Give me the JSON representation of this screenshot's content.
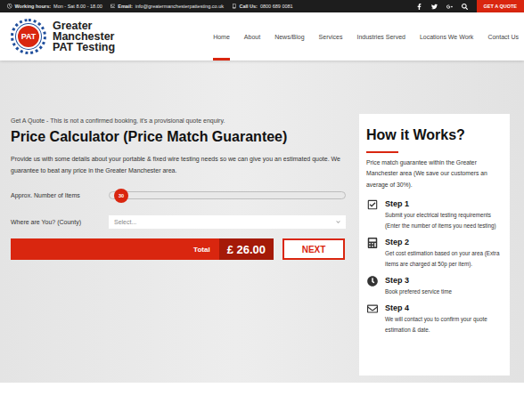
{
  "topbar": {
    "items": [
      {
        "label": "Working hours:",
        "value": "Mon - Sat 8.00 - 18.00"
      },
      {
        "label": "Email:",
        "value": "info@greatermanchesterpattesting.co.uk"
      },
      {
        "label": "Call Us:",
        "value": "0800 689 0081"
      }
    ],
    "quote_button": "GET A QUOTE"
  },
  "logo": {
    "badge": "PAT",
    "lines": [
      "Greater",
      "Manchester",
      "PAT Testing"
    ]
  },
  "nav": [
    {
      "label": "Home",
      "selected": true
    },
    {
      "label": "About",
      "selected": false
    },
    {
      "label": "News/Blog",
      "selected": false
    },
    {
      "label": "Services",
      "selected": false
    },
    {
      "label": "Industries Served",
      "selected": false
    },
    {
      "label": "Locations We Work",
      "selected": false
    },
    {
      "label": "Contact Us",
      "selected": false
    }
  ],
  "calculator": {
    "eyebrow": "Get A Quote - This is not a confirmed booking, it's a provisional quote enquiry.",
    "title": "Price Calculator (Price Match Guarantee)",
    "intro": "Provide us with some details about your portable & fixed wire testing needs so we can give you an estimated quote. We guarantee to beat any price in the Greater Manchester area.",
    "fields": [
      {
        "kind": "slider",
        "label": "Approx. Number of Items",
        "value": "30",
        "level": 0.02
      },
      {
        "kind": "select",
        "label": "Where are You? (County)",
        "placeholder": "Select..."
      }
    ],
    "total": {
      "label": "Total",
      "value": "£ 26.00"
    },
    "button": "NEXT"
  },
  "how_it_works": {
    "title": "How it Works?",
    "intro": "Price match guarantee within the Greater Manchester area (We save our customers an average of 30%).",
    "steps": [
      {
        "title": "Step 1",
        "text": "Submit your electrical testing requirements (Enter the number of items you need testing)"
      },
      {
        "title": "Step 2",
        "text": "Get cost estimation based on your area (Extra items are charged at 50p per item)."
      },
      {
        "title": "Step 3",
        "text": "Book prefered service time"
      },
      {
        "title": "Step 4",
        "text": "We will contact you to confirm your quote estimation & date."
      }
    ]
  }
}
